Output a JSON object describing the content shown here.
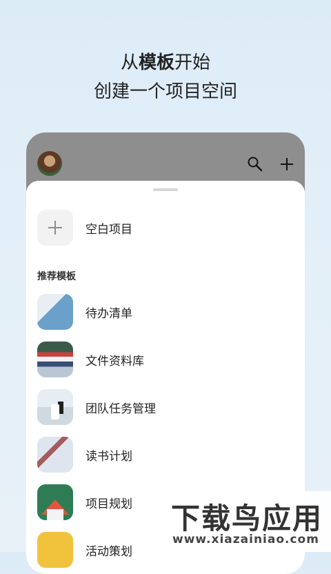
{
  "header": {
    "line1_pre": "从",
    "line1_bold": "模板",
    "line1_post": "开始",
    "line2": "创建一个项目空间"
  },
  "sheet": {
    "blank_label": "空白项目",
    "section_title": "推荐模板",
    "templates": [
      {
        "label": "待办清单",
        "icon": "notebook-image"
      },
      {
        "label": "文件资料库",
        "icon": "books-image"
      },
      {
        "label": "团队任务管理",
        "icon": "desk-image"
      },
      {
        "label": "读书计划",
        "icon": "reading-image"
      },
      {
        "label": "项目规划",
        "icon": "project-image"
      },
      {
        "label": "活动策划",
        "icon": "event-image"
      }
    ]
  },
  "watermark": {
    "title": "下载鸟应用",
    "url": "www.xiazainiao.com"
  }
}
